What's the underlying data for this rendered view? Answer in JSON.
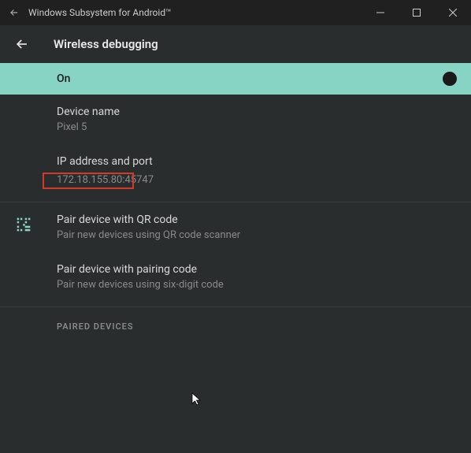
{
  "titlebar": {
    "title": "Windows Subsystem for Android™"
  },
  "header": {
    "title": "Wireless debugging"
  },
  "toggle": {
    "label": "On"
  },
  "device_name": {
    "label": "Device name",
    "value": "Pixel 5"
  },
  "ip_port": {
    "label": "IP address and port",
    "value": "172.18.155.80:45747"
  },
  "pair_qr": {
    "title": "Pair device with QR code",
    "subtitle": "Pair new devices using QR code scanner"
  },
  "pair_code": {
    "title": "Pair device with pairing code",
    "subtitle": "Pair new devices using six-digit code"
  },
  "paired_section": {
    "label": "PAIRED DEVICES"
  }
}
